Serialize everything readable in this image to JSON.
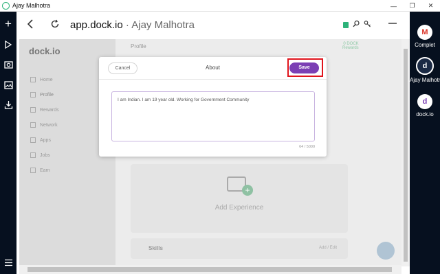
{
  "window": {
    "title": "Ajay Malhotra",
    "controls": [
      "—",
      "❐",
      "✕"
    ]
  },
  "left_rail": {
    "icons": [
      "plus-icon",
      "play-icon",
      "camera-icon",
      "image-icon",
      "download-icon",
      "menu-icon"
    ]
  },
  "right_rail": {
    "items": [
      {
        "label": "Complet",
        "avatar": "M",
        "color": "#d93025"
      },
      {
        "label": "Ajay Malhotra",
        "avatar": "d",
        "active": true
      },
      {
        "label": "dock.io",
        "avatar": "d",
        "color": "#7b3fb4"
      }
    ]
  },
  "browser": {
    "url_domain": "app.dock.io",
    "url_separator": "·",
    "url_name": "Ajay Malhotra"
  },
  "page": {
    "logo": "dock.io",
    "header": "Profile",
    "dock_balance_label": "0 DOCK",
    "dock_balance_sub": "Rewards",
    "nav": [
      "Home",
      "Profile",
      "Rewards",
      "Network",
      "Apps",
      "Jobs",
      "Earn"
    ],
    "experience_cta": "Add Experience",
    "skills_label": "Skills",
    "skills_action": "Add / Edit"
  },
  "modal": {
    "cancel_label": "Cancel",
    "title": "About",
    "save_label": "Save",
    "about_text": "I am Indian. I am 19 year old. Working for Government Community",
    "char_count": "64 / 5000"
  },
  "colors": {
    "accent": "#7b3fb4",
    "highlight": "#e0141c",
    "rail_bg": "#06101f",
    "secure": "#2db37a"
  }
}
